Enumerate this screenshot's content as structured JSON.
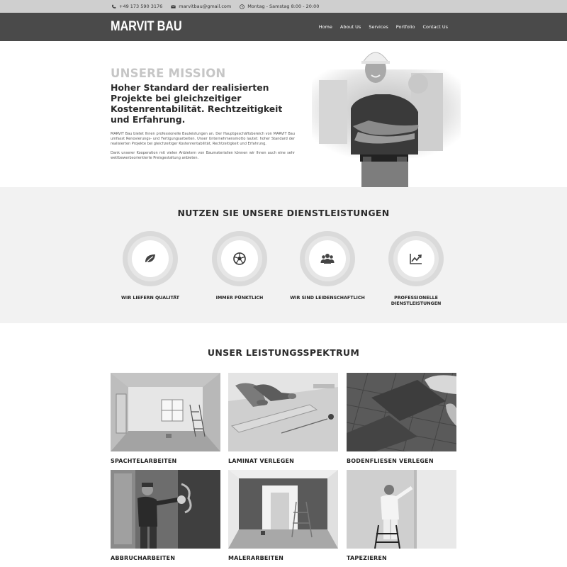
{
  "topbar": {
    "phone": "+49 173 590 3176",
    "email": "marvitbau@gmail.com",
    "hours": "Montag - Samstag 8:00 - 20:00"
  },
  "nav": {
    "brand": "MARVIT BAU",
    "items": [
      "Home",
      "About Us",
      "Services",
      "Portfolio",
      "Contact Us"
    ]
  },
  "hero": {
    "title": "UNSERE MISSION",
    "lead": "Hoher Standard der realisierten Projekte bei gleichzeitiger Kostenrentabilität. Rechtzeitigkeit und Erfahrung.",
    "p1": "MARVIT Bau bietet Ihnen professionelle Bauleistungen an. Der Hauptgeschäftsbereich von MARVIT Bau umfasst Renovierungs- und Fertigungsarbeiten. Unser Unternehmensmotto lautet: hoher Standard der realisierten Projekte bei gleichzeitiger Kostenrentabilität, Rechtzeitigkeit und Erfahrung.",
    "p2": "Dank unserer Kooperation mit vielen Anbietern von Baumaterialien können wir Ihnen auch eine sehr wettbewerbsorientierte Preisgestaltung anbieten."
  },
  "services": {
    "title": "NUTZEN SIE UNSERE DIENSTLEISTUNGEN",
    "items": [
      {
        "label": "WIR LIEFERN QUALITÄT",
        "icon": "leaf-icon"
      },
      {
        "label": "IMMER PÜNKTLICH",
        "icon": "soccer-ball-icon"
      },
      {
        "label": "WIR SIND LEIDENSCHAFTLICH",
        "icon": "users-icon"
      },
      {
        "label": "PROFESSIONELLE DIENSTLEISTUNGEN",
        "icon": "chart-line-icon"
      }
    ]
  },
  "spectrum": {
    "title": "UNSER LEISTUNGSSPEKTRUM",
    "items": [
      "SPACHTELARBEITEN",
      "LAMINAT VERLEGEN",
      "BODENFLIESEN VERLEGEN",
      "ABBRUCHARBEITEN",
      "MALERARBEITEN",
      "TAPEZIEREN"
    ]
  },
  "colors": {
    "topbar": "#cfcfcf",
    "nav": "#4a4a4a",
    "services_bg": "#f2f2f2",
    "mission_title": "#c6c6c6"
  }
}
